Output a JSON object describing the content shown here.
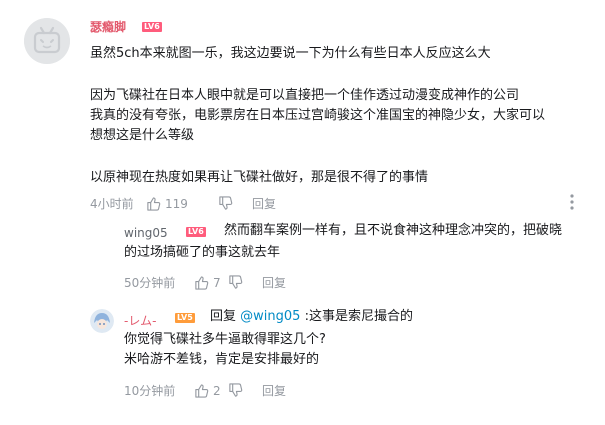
{
  "main_comment": {
    "username": "瑟瘾脚",
    "level": "LV6",
    "lines": [
      "虽然5ch本来就图一乐，我这边要说一下为什么有些日本人反应这么大",
      "因为飞碟社在日本人眼中就是可以直接把一个佳作透过动漫变成神作的公司",
      "我真的没有夸张，电影票房在日本压过宫崎骏这个准国宝的神隐少女，大家可以",
      "想想这是什么等级",
      "以原神现在热度如果再让飞碟社做好，那是很不得了的事情"
    ],
    "time": "4小时前",
    "likes": "119",
    "reply_label": "回复"
  },
  "replies": [
    {
      "username": "wing05",
      "level": "LV6",
      "line1": "然而翻车案例一样有，且不说食神这种理念冲突的，把破晓",
      "line2": "的过场搞砸了的事这就去年",
      "time": "50分钟前",
      "likes": "7",
      "reply_label": "回复"
    },
    {
      "username": "-レム-",
      "level": "LV5",
      "reply_prefix": "回复",
      "mention": "@wing05",
      "line1_rest": ":这事是索尼撮合的",
      "line2": "你觉得飞碟社多牛逼敢得罪这几个?",
      "line3": "米哈游不差钱，肯定是安排最好的",
      "time": "10分钟前",
      "likes": "2",
      "reply_label": "回复"
    }
  ],
  "colors": {
    "accent_username": "#e35b6e",
    "link": "#008ac5",
    "meta": "#9499a0"
  },
  "icons": [
    "bilibili-tv-avatar-icon",
    "thumb-up-icon",
    "thumb-down-icon",
    "more-dots-icon",
    "anime-avatar-icon"
  ]
}
